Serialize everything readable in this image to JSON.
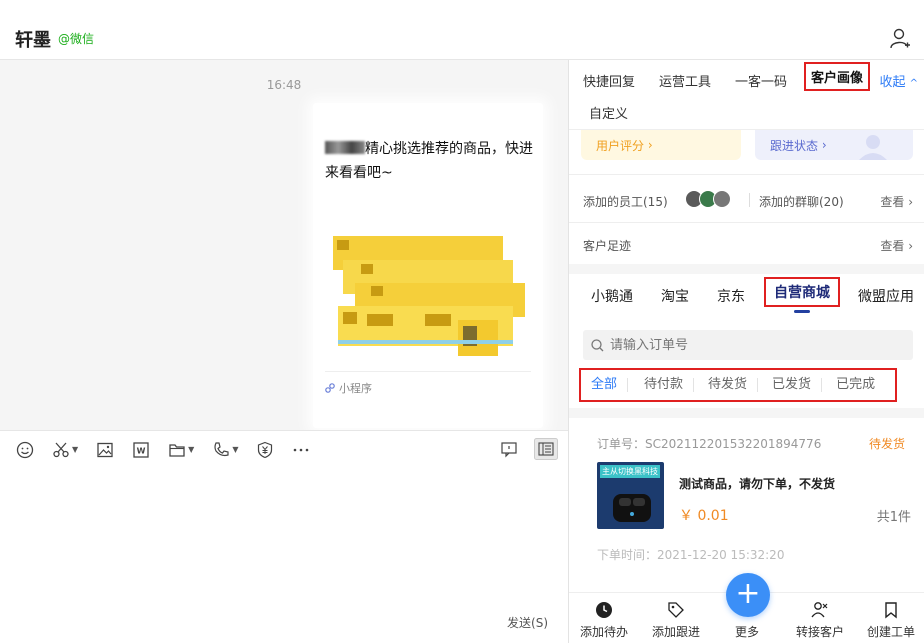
{
  "window": {
    "minimize": "—",
    "maximize": "☐",
    "close": "✕"
  },
  "header": {
    "title": "轩墨",
    "source": "@微信"
  },
  "chat": {
    "time": "16:48",
    "card": {
      "text": "精心挑选推荐的商品，快进来看看吧~",
      "mini_program_label": "小程序"
    }
  },
  "toolbar": {
    "send_label": "发送(S)"
  },
  "panel": {
    "top_tabs": [
      "快捷回复",
      "运营工具",
      "一客一码",
      "客户画像",
      "自定义"
    ],
    "active_top_tab": "客户画像",
    "collapse_label": "收起",
    "stats": {
      "rating": "用户评分",
      "follow": "跟进状态"
    },
    "staff": {
      "label": "添加的员工(15)",
      "groups": "添加的群聊(20)",
      "view": "查看"
    },
    "footprint": {
      "label": "客户足迹",
      "view": "查看"
    },
    "shop_tabs": [
      "小鹅通",
      "淘宝",
      "京东",
      "自营商城",
      "微盟应用"
    ],
    "active_shop_tab": "自营商城",
    "search": {
      "placeholder": "请输入订单号"
    },
    "status_tabs": [
      "全部",
      "待付款",
      "待发货",
      "已发货",
      "已完成"
    ],
    "active_status_tab": "全部",
    "order": {
      "number": "订单号：SC20211220153220189477​6",
      "status": "待发货",
      "image_text": "主从切换黑科技",
      "name": "测试商品，请勿下单，不发货",
      "price": "￥ 0.01",
      "qty": "共1件",
      "time": "下单时间：2021-12-20 15:32:20"
    },
    "bottom": {
      "todo": "添加待办",
      "follow": "添加跟进",
      "more": "更多",
      "transfer": "转接客户",
      "ticket": "创建工单"
    }
  }
}
